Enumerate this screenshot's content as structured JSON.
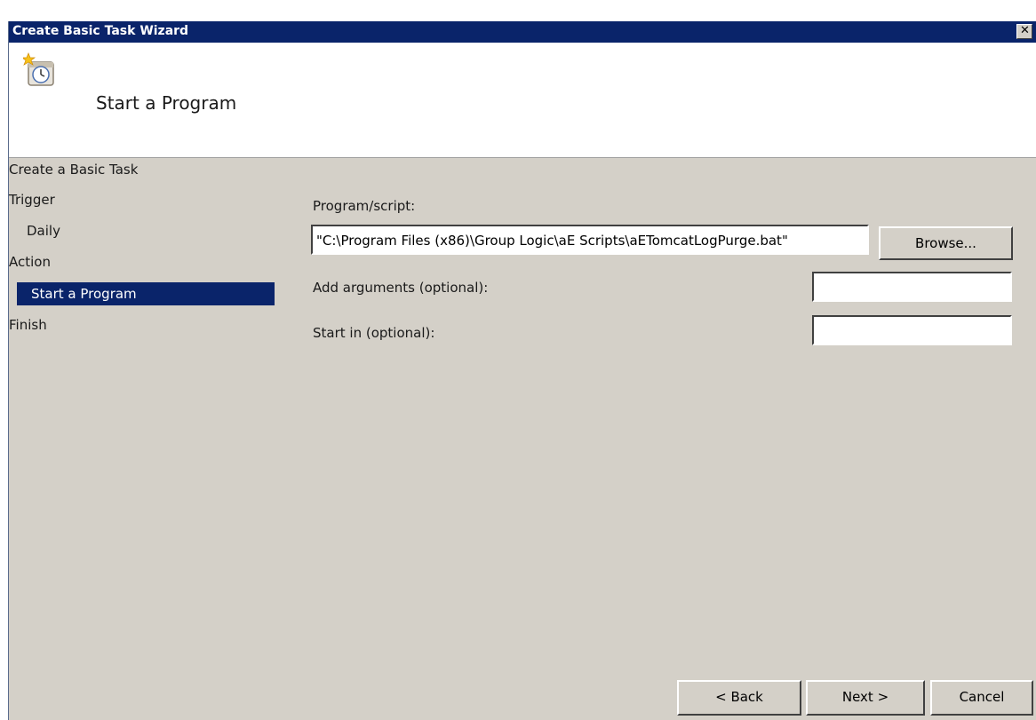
{
  "window": {
    "title": "Create Basic Task Wizard",
    "close_glyph": "✕"
  },
  "header": {
    "title": "Start a Program",
    "icon": "task-scheduler-clock-icon"
  },
  "steps": [
    {
      "label": "Create a Basic Task",
      "level": 0,
      "selected": false
    },
    {
      "label": "Trigger",
      "level": 0,
      "selected": false
    },
    {
      "label": "Daily",
      "level": 1,
      "selected": false
    },
    {
      "label": "Action",
      "level": 0,
      "selected": false
    },
    {
      "label": "Start a Program",
      "level": 1,
      "selected": true
    },
    {
      "label": "Finish",
      "level": 0,
      "selected": false
    }
  ],
  "form": {
    "program_label": "Program/script:",
    "program_value": "\"C:\\Program Files (x86)\\Group Logic\\aE Scripts\\aETomcatLogPurge.bat\"",
    "browse_label": "Browse...",
    "arguments_label": "Add arguments (optional):",
    "arguments_value": "",
    "start_in_label": "Start in (optional):",
    "start_in_value": ""
  },
  "footer": {
    "back_label": "< Back",
    "next_label": "Next >",
    "cancel_label": "Cancel"
  },
  "colors": {
    "titlebar": "#0a246a",
    "selected_step": "#0a246a",
    "dialog_background": "#d4d0c8",
    "header_background": "#ffffff"
  }
}
